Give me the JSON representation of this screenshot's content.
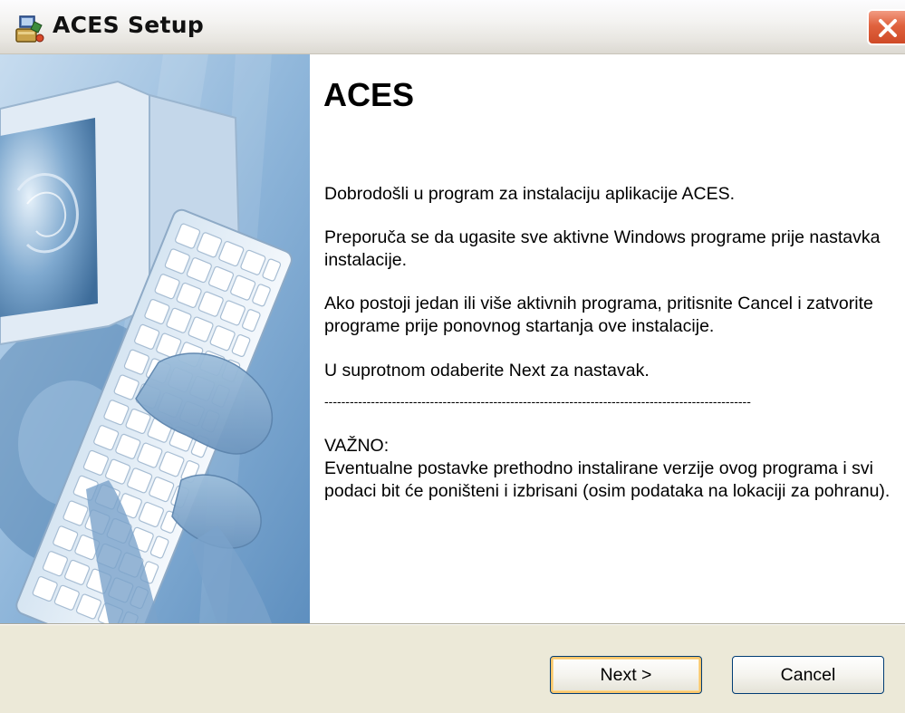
{
  "window": {
    "title": "ACES Setup",
    "close_label": "Close"
  },
  "content": {
    "heading": "ACES",
    "welcome": "Dobrodošli u program za instalaciju aplikacije ACES.",
    "recommendation": "Preporuča se da ugasite sve aktivne Windows programe prije nastavka instalacije.",
    "if_active": "Ako postoji jedan ili više aktivnih programa, pritisnite Cancel i zatvorite programe prije ponovnog startanja ove instalacije.",
    "otherwise": "U suprotnom odaberite Next za nastavak.",
    "separator": "-----------------------------------------------------------------------------------------------------",
    "important_title": "VAŽNO:",
    "important_text": "Eventualne postavke prethodno instalirane verzije ovog programa i svi podaci bit će poništeni i izbrisani (osim podataka na lokaciji za pohranu)."
  },
  "buttons": {
    "next_label": "Next >",
    "cancel_label": "Cancel"
  },
  "icons": {
    "title_icon": "setup-installer-icon",
    "close_icon": "close-x-icon"
  },
  "colors": {
    "dialog_background": "#ece9d8",
    "content_background": "#ffffff",
    "close_button": "#e0623e",
    "default_button_focus": "#f9c56a"
  }
}
